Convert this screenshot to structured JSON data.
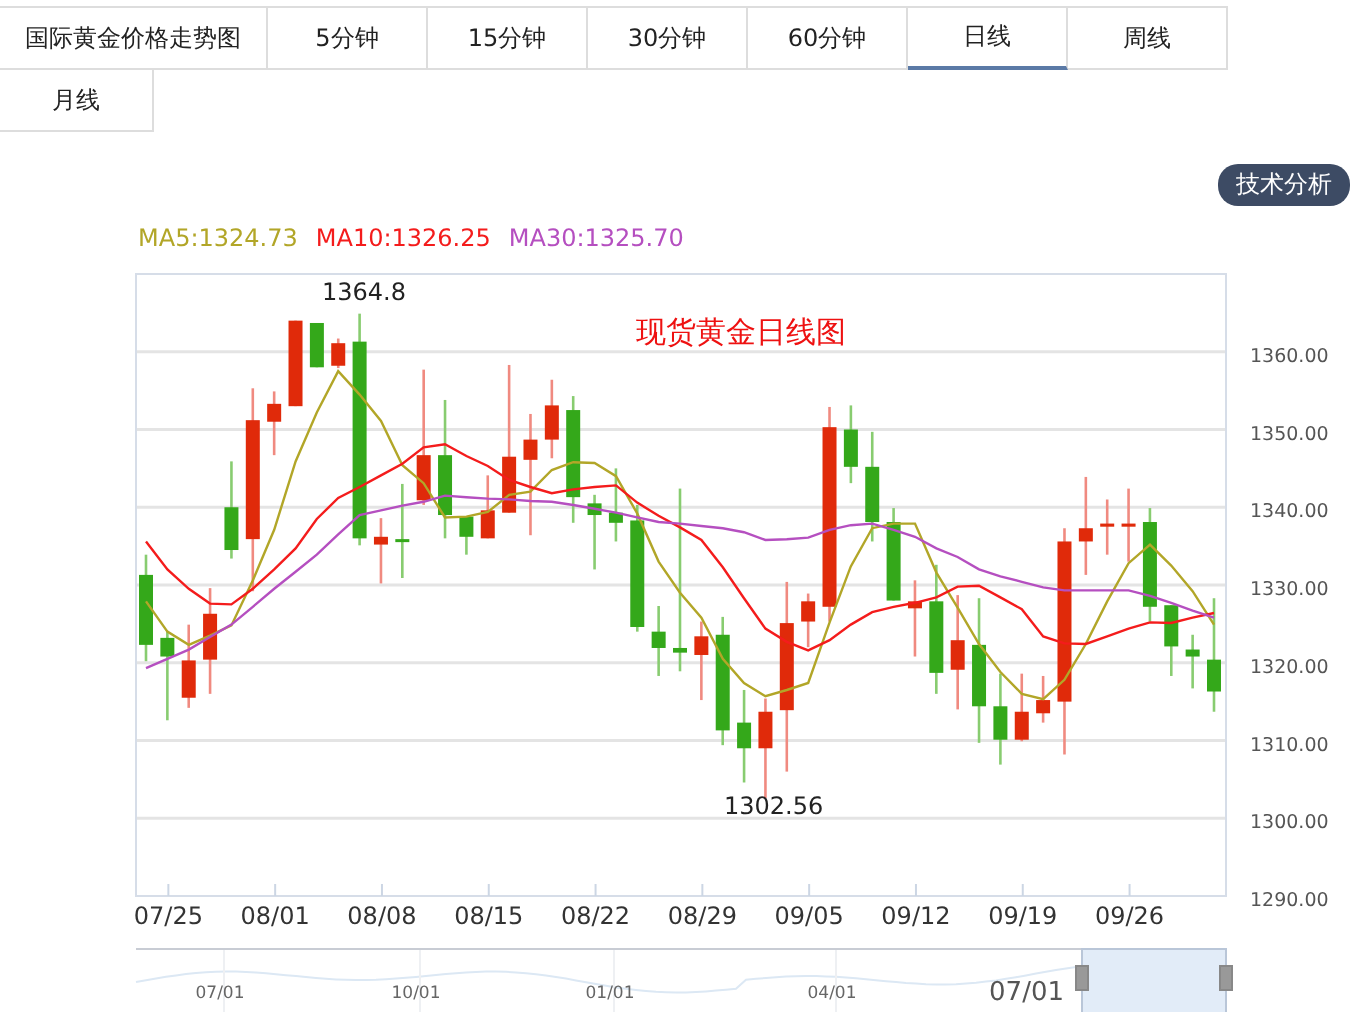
{
  "tabs": [
    {
      "label": "国际黄金价格走势图",
      "selected": false
    },
    {
      "label": "5分钟",
      "selected": false
    },
    {
      "label": "15分钟",
      "selected": false
    },
    {
      "label": "30分钟",
      "selected": false
    },
    {
      "label": "60分钟",
      "selected": false
    },
    {
      "label": "日线",
      "selected": true
    },
    {
      "label": "周线",
      "selected": false
    },
    {
      "label": "月线",
      "selected": false
    }
  ],
  "analysis_button": {
    "label": "技术分析"
  },
  "chart": {
    "high_label": "1364.8",
    "low_label": "1302.56",
    "chart_data": {
      "type": "candlestick",
      "title": "现货黄金日线图",
      "grid": true,
      "ylim": [
        1290,
        1370
      ],
      "yticks": [
        {
          "value": 1360,
          "label": "1360.00"
        },
        {
          "value": 1350,
          "label": "1350.00"
        },
        {
          "value": 1340,
          "label": "1340.00"
        },
        {
          "value": 1330,
          "label": "1330.00"
        },
        {
          "value": 1320,
          "label": "1320.00"
        },
        {
          "value": 1310,
          "label": "1310.00"
        },
        {
          "value": 1300,
          "label": "1300.00"
        },
        {
          "value": 1290,
          "label": "1290.00"
        }
      ],
      "categories": [
        null,
        "07/25",
        null,
        null,
        null,
        null,
        "08/01",
        null,
        null,
        null,
        null,
        "08/08",
        null,
        null,
        null,
        null,
        "08/15",
        null,
        null,
        null,
        null,
        "08/22",
        null,
        null,
        null,
        null,
        "08/29",
        null,
        null,
        null,
        null,
        "09/05",
        null,
        null,
        null,
        null,
        "09/12",
        null,
        null,
        null,
        null,
        "09/19",
        null,
        null,
        null,
        null,
        "09/26",
        null,
        null,
        null,
        null
      ],
      "ohlc": [
        [
          1331.3,
          1333.9,
          1320.2,
          1322.3
        ],
        [
          1323.2,
          1324.0,
          1312.6,
          1320.8
        ],
        [
          1315.5,
          1324.9,
          1314.2,
          1320.3
        ],
        [
          1320.4,
          1329.6,
          1316.0,
          1326.3
        ],
        [
          1340.0,
          1345.9,
          1333.4,
          1334.5
        ],
        [
          1335.9,
          1355.3,
          1329.2,
          1351.2
        ],
        [
          1351.0,
          1354.9,
          1346.7,
          1353.3
        ],
        [
          1353.0,
          1364.0,
          1353.0,
          1364.0
        ],
        [
          1363.7,
          1363.7,
          1358.0,
          1358.0
        ],
        [
          1358.2,
          1361.7,
          1357.9,
          1361.1
        ],
        [
          1361.3,
          1364.9,
          1335.1,
          1336.0
        ],
        [
          1335.2,
          1338.6,
          1330.2,
          1336.2
        ],
        [
          1335.9,
          1343.0,
          1330.9,
          1335.7
        ],
        [
          1340.9,
          1357.7,
          1340.3,
          1346.7
        ],
        [
          1346.7,
          1353.8,
          1336.0,
          1339.0
        ],
        [
          1338.8,
          1338.8,
          1333.9,
          1336.2
        ],
        [
          1336.0,
          1344.1,
          1336.0,
          1339.6
        ],
        [
          1339.3,
          1358.3,
          1339.3,
          1346.5
        ],
        [
          1346.1,
          1352.0,
          1336.4,
          1348.7
        ],
        [
          1348.7,
          1356.4,
          1346.3,
          1353.1
        ],
        [
          1352.5,
          1354.3,
          1338.0,
          1341.3
        ],
        [
          1340.5,
          1341.6,
          1332.0,
          1339.0
        ],
        [
          1339.3,
          1345.0,
          1335.6,
          1338.0
        ],
        [
          1338.3,
          1340.3,
          1324.0,
          1324.6
        ],
        [
          1324.0,
          1327.3,
          1318.3,
          1321.9
        ],
        [
          1321.9,
          1342.4,
          1318.9,
          1321.3
        ],
        [
          1321.0,
          1325.3,
          1315.2,
          1323.4
        ],
        [
          1323.6,
          1325.9,
          1309.4,
          1311.3
        ],
        [
          1312.3,
          1316.5,
          1304.6,
          1309.0
        ],
        [
          1309.0,
          1315.4,
          1302.6,
          1313.7
        ],
        [
          1313.9,
          1330.4,
          1306.0,
          1325.1
        ],
        [
          1325.3,
          1328.9,
          1322.0,
          1327.9
        ],
        [
          1327.2,
          1352.9,
          1325.3,
          1350.3
        ],
        [
          1350.0,
          1353.1,
          1343.1,
          1345.2
        ],
        [
          1345.2,
          1349.7,
          1335.6,
          1338.1
        ],
        [
          1338.1,
          1339.9,
          1328.0,
          1328.0
        ],
        [
          1327.0,
          1330.6,
          1320.8,
          1327.9
        ],
        [
          1327.9,
          1332.6,
          1316.0,
          1318.7
        ],
        [
          1319.1,
          1328.7,
          1314.0,
          1322.9
        ],
        [
          1322.3,
          1328.3,
          1309.7,
          1314.4
        ],
        [
          1314.4,
          1318.6,
          1306.9,
          1310.1
        ],
        [
          1310.1,
          1318.6,
          1309.9,
          1313.7
        ],
        [
          1313.5,
          1318.3,
          1312.3,
          1315.2
        ],
        [
          1315.0,
          1337.3,
          1308.2,
          1335.6
        ],
        [
          1335.6,
          1343.9,
          1331.3,
          1337.3
        ],
        [
          1337.5,
          1341.0,
          1333.9,
          1337.9
        ],
        [
          1337.5,
          1342.4,
          1333.0,
          1337.9
        ],
        [
          1338.1,
          1339.9,
          1325.3,
          1327.2
        ],
        [
          1327.4,
          1327.4,
          1318.3,
          1322.1
        ],
        [
          1321.7,
          1323.6,
          1316.7,
          1320.8
        ],
        [
          1320.4,
          1328.3,
          1313.7,
          1316.3
        ]
      ],
      "series": [
        {
          "name": "MA5:1324.73",
          "type": "line",
          "color": "#b2a628",
          "values": [
            1327.9,
            1324.0,
            1322.3,
            1323.5,
            1324.8,
            1330.6,
            1337.1,
            1345.9,
            1352.2,
            1357.5,
            1354.5,
            1351.1,
            1345.4,
            1343.1,
            1338.7,
            1338.8,
            1339.4,
            1341.6,
            1342.0,
            1344.8,
            1345.8,
            1345.7,
            1344.0,
            1339.2,
            1333.0,
            1329.0,
            1325.8,
            1320.5,
            1317.4,
            1315.7,
            1316.5,
            1317.4,
            1325.2,
            1332.4,
            1337.3,
            1337.9,
            1337.9,
            1331.6,
            1327.1,
            1322.4,
            1318.8,
            1316.0,
            1315.3,
            1317.8,
            1322.4,
            1327.9,
            1332.8,
            1335.2,
            1332.5,
            1329.2,
            1324.9
          ]
        },
        {
          "name": "MA10:1326.25",
          "type": "line",
          "color": "#f41c1c",
          "values": [
            1335.6,
            1332.0,
            1329.5,
            1327.6,
            1327.5,
            1329.5,
            1332.0,
            1334.7,
            1338.5,
            1341.2,
            1342.6,
            1344.1,
            1345.6,
            1347.7,
            1348.1,
            1346.6,
            1345.3,
            1343.5,
            1342.6,
            1341.8,
            1342.3,
            1342.6,
            1342.8,
            1340.6,
            1338.9,
            1337.4,
            1335.8,
            1332.3,
            1328.3,
            1324.4,
            1322.7,
            1321.6,
            1322.9,
            1324.9,
            1326.5,
            1327.2,
            1327.7,
            1328.4,
            1329.8,
            1329.9,
            1328.4,
            1326.9,
            1323.4,
            1322.5,
            1322.4,
            1323.4,
            1324.4,
            1325.2,
            1325.1,
            1325.8,
            1326.4
          ]
        },
        {
          "name": "MA30:1325.70",
          "type": "line",
          "color": "#b54fc0",
          "values": [
            1319.3,
            1320.5,
            1321.7,
            1323.3,
            1324.9,
            1327.2,
            1329.5,
            1331.7,
            1333.9,
            1336.5,
            1339.0,
            1339.6,
            1340.2,
            1340.7,
            1341.5,
            1341.3,
            1341.1,
            1341.0,
            1340.8,
            1340.7,
            1340.3,
            1339.8,
            1339.3,
            1338.7,
            1338.1,
            1337.9,
            1337.6,
            1337.3,
            1336.8,
            1335.8,
            1335.9,
            1336.1,
            1337.1,
            1337.7,
            1337.9,
            1337.1,
            1336.2,
            1334.7,
            1333.6,
            1332.0,
            1331.1,
            1330.4,
            1329.7,
            1329.3,
            1329.3,
            1329.3,
            1329.3,
            1328.6,
            1327.7,
            1326.7,
            1325.8
          ]
        }
      ]
    }
  },
  "navigator": {
    "labels": [
      "07/01",
      "10/01",
      "01/01",
      "04/01"
    ],
    "range_start_label": "07/01"
  }
}
